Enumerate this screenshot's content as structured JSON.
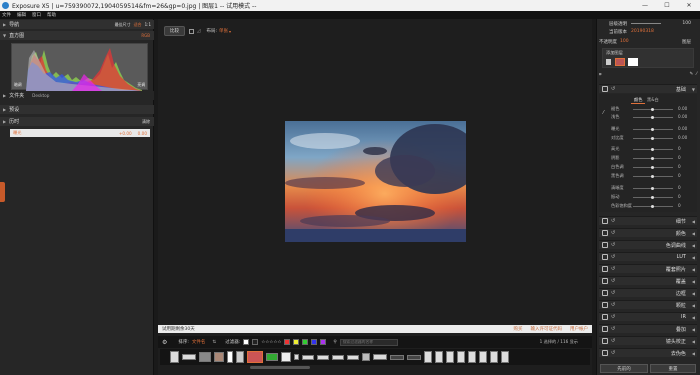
{
  "titlebar": {
    "title": "Exposure X5 | u=759390072,1904059514&fm=26&gp=0.jpg | 图层1 -- 试用模式 --",
    "minimize": "—",
    "maximize": "☐",
    "close": "✕"
  },
  "menu": [
    "文件",
    "编辑",
    "窗口",
    "帮助"
  ],
  "left": {
    "nav": {
      "title": "导航",
      "zoom_fit": "最佳尺寸",
      "zoom_pct": "适合",
      "zoom_1": "1:1"
    },
    "histogram": {
      "title": "直方图",
      "mode": "RGB",
      "left_label": "暗调",
      "right_label": "亮调"
    },
    "folder": {
      "title": "文件夹",
      "value": "Desktop"
    },
    "presets": {
      "title": "预设"
    },
    "history": {
      "title": "历时",
      "clear": "清除",
      "items": [
        {
          "label": "曝光",
          "value": "+0.00",
          "value2": "0.00"
        }
      ]
    }
  },
  "viewer": {
    "compare_btn": "比较",
    "layout_label": "布局:",
    "layout_value": "单张",
    "status_left": "试用期剩余30天",
    "status_right1": "购买",
    "status_right2": "输入许可证代码",
    "status_right3": "用户帐户",
    "sort_label": "排序:",
    "sort_value": "文件名",
    "filter_label": "过滤器:",
    "search_placeholder": "搜索过滤器的名称",
    "counter": "1 选择的 / 116 显示"
  },
  "right": {
    "opacity_label": "层级透明",
    "opacity_value": "100",
    "version_label": "当前版本",
    "version_value": "20190318",
    "layer_mode_label": "不透明度",
    "layer_mode_value": "100",
    "layer_label": "图层",
    "add_layer": "添加图层",
    "basic": {
      "title": "基础",
      "tab_color": "颜色",
      "tab_bw": "黑&白",
      "sliders": [
        {
          "label": "褪色",
          "value": "0.00"
        },
        {
          "label": "浅色",
          "value": "0.00"
        },
        {
          "label": "曝光",
          "value": "0.00"
        },
        {
          "label": "对比度",
          "value": "0.00"
        },
        {
          "label": "高光",
          "value": "0"
        },
        {
          "label": "阴影",
          "value": "0"
        },
        {
          "label": "白色调",
          "value": "0"
        },
        {
          "label": "黑色调",
          "value": "0"
        },
        {
          "label": "清晰度",
          "value": "0"
        },
        {
          "label": "振动",
          "value": "0"
        },
        {
          "label": "色彩饱和度",
          "value": "0"
        }
      ]
    },
    "sections": [
      "细节",
      "颜色",
      "色调曲线",
      "LUT",
      "覆套照片",
      "覆盖",
      "边框",
      "颗粒",
      "IR",
      "叠加",
      "镜头校正",
      "去伪色"
    ],
    "prev_btn": "先前的",
    "reset_btn": "重置"
  },
  "colors": {
    "accent": "#e0703a"
  }
}
